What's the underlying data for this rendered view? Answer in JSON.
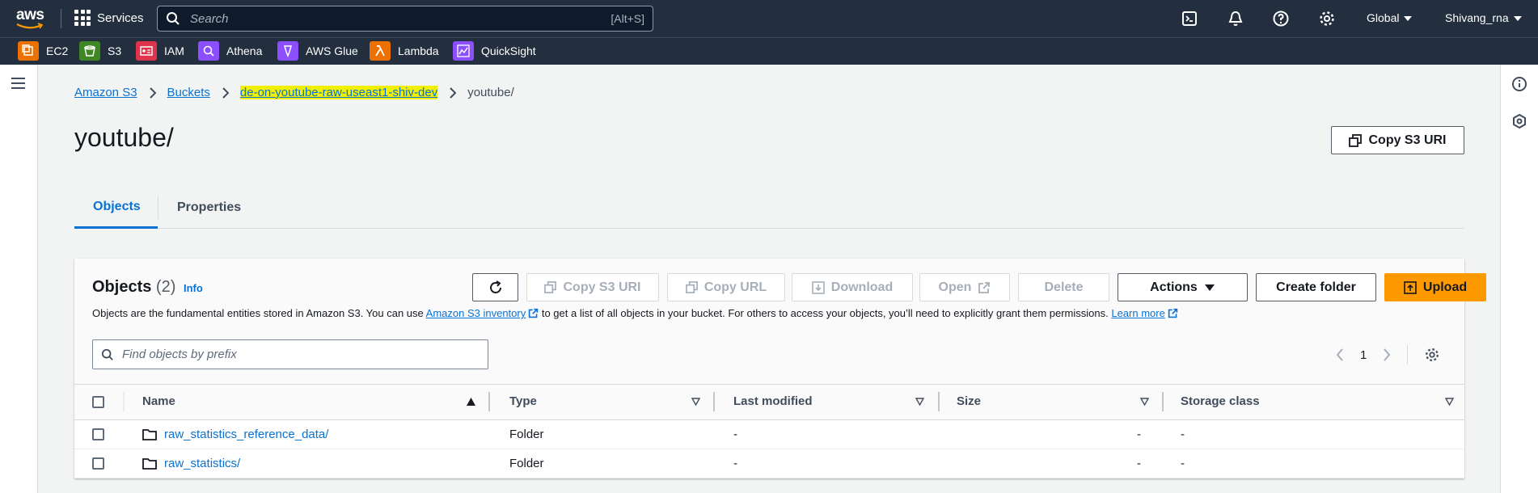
{
  "topnav": {
    "logo": "aws",
    "services_label": "Services",
    "search_placeholder": "Search",
    "search_shortcut": "[Alt+S]",
    "region": "Global",
    "account": "Shivang_rna"
  },
  "favorites": [
    {
      "label": "EC2",
      "color": "#ed7100",
      "icon": "ec2-icon"
    },
    {
      "label": "S3",
      "color": "#3f8624",
      "icon": "s3-icon"
    },
    {
      "label": "IAM",
      "color": "#dd344c",
      "icon": "iam-icon"
    },
    {
      "label": "Athena",
      "color": "#8c4fff",
      "icon": "athena-icon"
    },
    {
      "label": "AWS Glue",
      "color": "#8c4fff",
      "icon": "glue-icon"
    },
    {
      "label": "Lambda",
      "color": "#ed7100",
      "icon": "lambda-icon"
    },
    {
      "label": "QuickSight",
      "color": "#8c4fff",
      "icon": "quicksight-icon"
    }
  ],
  "breadcrumbs": {
    "items": [
      "Amazon S3",
      "Buckets",
      "de-on-youtube-raw-useast1-shiv-dev"
    ],
    "current": "youtube/"
  },
  "page": {
    "title": "youtube/",
    "copy_uri_label": "Copy S3 URI"
  },
  "tabs": [
    {
      "label": "Objects",
      "active": true
    },
    {
      "label": "Properties",
      "active": false
    }
  ],
  "objects_panel": {
    "title": "Objects",
    "count": "(2)",
    "info": "Info",
    "desc_before": "Objects are the fundamental entities stored in Amazon S3. You can use ",
    "desc_link": "Amazon S3 inventory",
    "desc_middle": " to get a list of all objects in your bucket. For others to access your objects, you’ll need to explicitly grant them permissions. ",
    "desc_learn": "Learn more",
    "buttons": {
      "copy_s3_uri": "Copy S3 URI",
      "copy_url": "Copy URL",
      "download": "Download",
      "open": "Open",
      "delete": "Delete",
      "actions": "Actions",
      "create_folder": "Create folder",
      "upload": "Upload"
    },
    "filter_placeholder": "Find objects by prefix",
    "page_number": "1",
    "columns": [
      "Name",
      "Type",
      "Last modified",
      "Size",
      "Storage class"
    ],
    "rows": [
      {
        "name": "raw_statistics_reference_data/",
        "type": "Folder",
        "last_modified": "-",
        "size": "-",
        "storage_class": "-"
      },
      {
        "name": "raw_statistics/",
        "type": "Folder",
        "last_modified": "-",
        "size": "-",
        "storage_class": "-"
      }
    ]
  },
  "colors": {
    "nav_bg": "#232f3e",
    "link": "#0972d3",
    "primary": "#ff9900",
    "highlight": "#f0f000"
  }
}
